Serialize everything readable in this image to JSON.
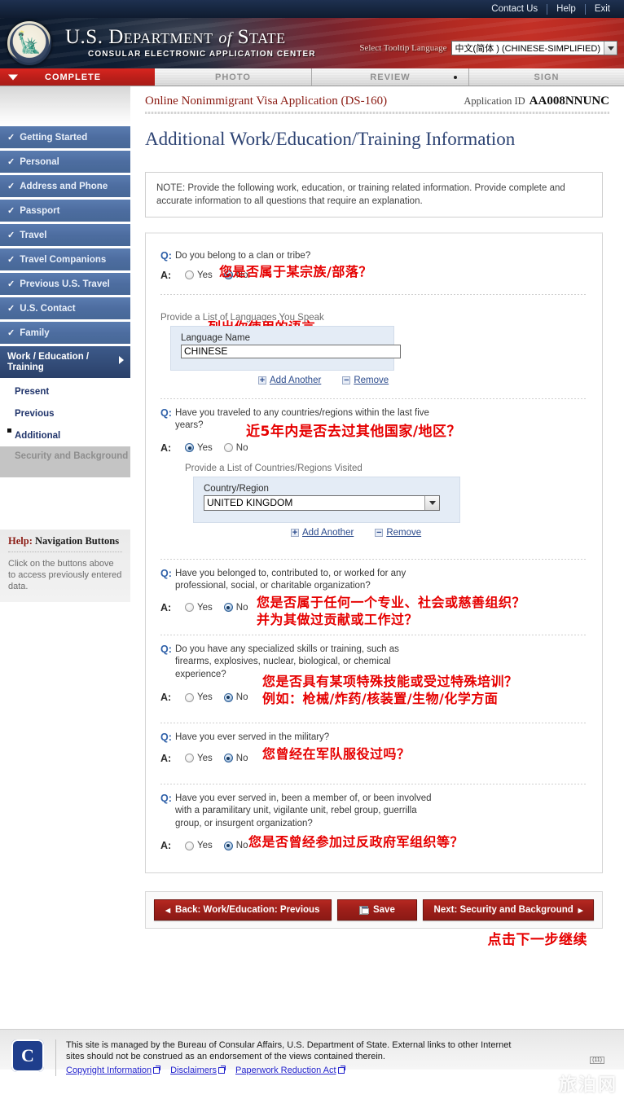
{
  "utility": {
    "links": [
      "Contact Us",
      "Help",
      "Exit"
    ]
  },
  "banner": {
    "title_us": "U.S.",
    "title_department": "D",
    "title_department_rest": "EPARTMENT",
    "title_of": "of",
    "title_state": "S",
    "title_state_rest": "TATE",
    "subtitle": "CONSULAR ELECTRONIC APPLICATION CENTER",
    "tooltip_label": "Select Tooltip Language",
    "tooltip_value": "中文(简体 ) (CHINESE-SIMPLIFIED)"
  },
  "tabs": [
    {
      "label": "COMPLETE",
      "state": "active"
    },
    {
      "label": "PHOTO",
      "state": "inactive"
    },
    {
      "label": "REVIEW",
      "state": "inactive"
    },
    {
      "label": "SIGN",
      "state": "inactive"
    }
  ],
  "sidebar": {
    "items": [
      {
        "label": "Getting Started",
        "done": true
      },
      {
        "label": "Personal",
        "done": true
      },
      {
        "label": "Address and Phone",
        "done": true
      },
      {
        "label": "Passport",
        "done": true
      },
      {
        "label": "Travel",
        "done": true
      },
      {
        "label": "Travel Companions",
        "done": true
      },
      {
        "label": "Previous U.S. Travel",
        "done": true
      },
      {
        "label": "U.S. Contact",
        "done": true
      },
      {
        "label": "Family",
        "done": true
      }
    ],
    "current": "Work / Education / Training",
    "sub_items": [
      {
        "label": "Present",
        "active": false
      },
      {
        "label": "Previous",
        "active": false
      },
      {
        "label": "Additional",
        "active": true
      }
    ],
    "disabled_item": "Security and Background",
    "help_title_red": "Help:",
    "help_title_black": "Navigation Buttons",
    "help_text": "Click on the buttons above to access previously entered data."
  },
  "header": {
    "app_title": "Online Nonimmigrant Visa Application (DS-160)",
    "app_id_label": "Application ID",
    "app_id_value": "AA008NNUNC",
    "page_title": "Additional Work/Education/Training Information",
    "note": "NOTE: Provide the following work, education, or training related information. Provide complete and accurate information to all questions that require an explanation."
  },
  "form": {
    "q_marker": "Q:",
    "a_marker": "A:",
    "yes_label": "Yes",
    "no_label": "No",
    "add_another": "Add Another",
    "remove": "Remove",
    "add_sign": "+",
    "remove_sign": "−",
    "questions": [
      {
        "text": "Do you belong to a clan or tribe?",
        "answer": "No",
        "annotation": "您是否属于某宗族/部落？"
      },
      {
        "text": "Have you traveled to any countries/regions within the last five years?",
        "answer": "Yes",
        "annotation": "近5年内是否去过其他国家/地区？"
      },
      {
        "text": "Have you belonged to, contributed to, or worked for any professional, social, or charitable organization?",
        "answer": "No",
        "annotation_line1": "您是否属于任何一个专业、社会或慈善组织？",
        "annotation_line2": "并为其做过贡献或工作过？"
      },
      {
        "text": "Do you have any specialized skills or training, such as firearms, explosives, nuclear, biological, or chemical experience?",
        "answer": "No",
        "annotation_line1": "您是否具有某项特殊技能或受过特殊培训？",
        "annotation_line2": "例如：枪械/炸药/核装置/生物/化学方面"
      },
      {
        "text": "Have you ever served in the military?",
        "answer": "No",
        "annotation": "您曾经在军队服役过吗？"
      },
      {
        "text": "Have you ever served in, been a member of, or been involved with a paramilitary unit, vigilante unit, rebel group, guerrilla group, or insurgent organization?",
        "answer": "No",
        "annotation": "您是否曾经参加过反政府军组织等？"
      }
    ],
    "languages_section": {
      "heading": "Provide a List of Languages You Speak",
      "annotation": "列出你使用的语言",
      "field_label": "Language Name",
      "value": "CHINESE"
    },
    "countries_section": {
      "heading": "Provide a List of Countries/Regions Visited",
      "field_label": "Country/Region",
      "value": "UNITED KINGDOM"
    }
  },
  "buttons": {
    "back": "Back: Work/Education: Previous",
    "back_arrow": "◂",
    "save": "Save",
    "next": "Next: Security and Background",
    "next_arrow": "▸",
    "annotation": "点击下一步继续"
  },
  "footer": {
    "seal_letter": "C",
    "text_line1": "This site is managed by the Bureau of Consular Affairs, U.S. Department of State. External links to other Internet",
    "text_line2": "sites should not be construed as an endorsement of the views contained therein.",
    "links": [
      "Copyright Information",
      "Disclaimers",
      "Paperwork Reduction Act"
    ],
    "page_number": "(11)",
    "watermark": "旅泊网"
  }
}
